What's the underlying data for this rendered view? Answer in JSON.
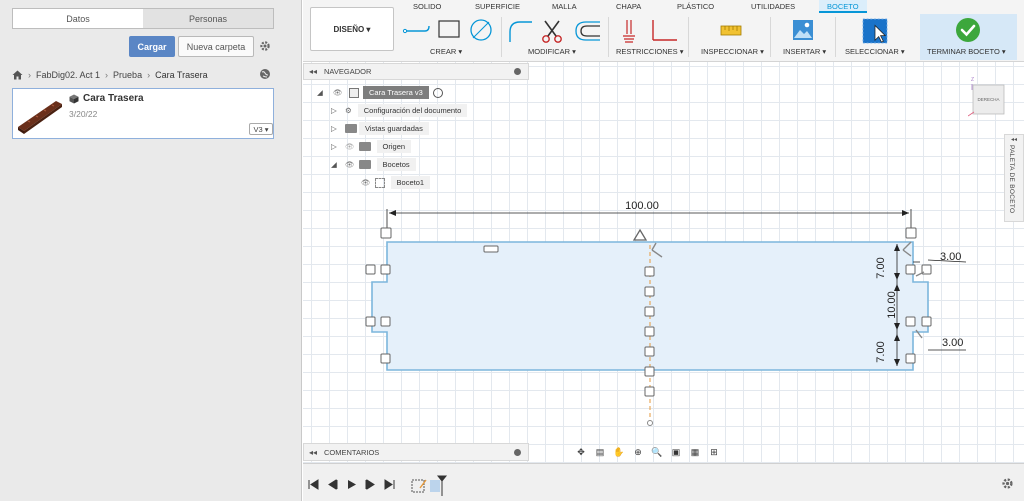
{
  "left_panel": {
    "tabs": [
      "Datos",
      "Personas"
    ],
    "active_tab": "Datos",
    "upload_label": "Cargar",
    "new_folder_label": "Nueva carpeta",
    "breadcrumb": [
      "FabDig02. Act 1",
      "Prueba",
      "Cara Trasera"
    ],
    "file": {
      "name": "Cara Trasera",
      "date": "3/20/22",
      "version": "V3 ▾"
    }
  },
  "toolbar": {
    "workspace": "DISEÑO ▾",
    "tabs": [
      "SOLIDO",
      "SUPERFICIE",
      "MALLA",
      "CHAPA",
      "PLÁSTICO",
      "UTILIDADES",
      "BOCETO"
    ],
    "active_tab": "BOCETO",
    "groups": [
      "CREAR ▾",
      "MODIFICAR ▾",
      "RESTRICCIONES ▾",
      "INSPECCIONAR ▾",
      "INSERTAR ▾",
      "SELECCIONAR ▾",
      "TERMINAR BOCETO ▾"
    ]
  },
  "navigator": {
    "title": "NAVEGADOR",
    "root": "Cara Trasera v3",
    "items": [
      "Configuración del documento",
      "Vistas guardadas",
      "Origen",
      "Bocetos",
      "Boceto1"
    ]
  },
  "comments_label": "COMENTARIOS",
  "sketch_palette_label": "PALETA DE BOCETO",
  "viewcube_label": "DERECHA",
  "dimensions": {
    "overall_width": "100.00",
    "top_segment": "7.00",
    "middle_segment": "10.00",
    "bottom_segment": "7.00",
    "notch_depth_top": "3.00",
    "notch_depth_bottom": "3.00"
  },
  "colors": {
    "accent": "#0696d7",
    "sketch_line": "#7cb6dc",
    "sketch_fill": "#e5f0fa",
    "finish_check": "#3ca73c"
  }
}
